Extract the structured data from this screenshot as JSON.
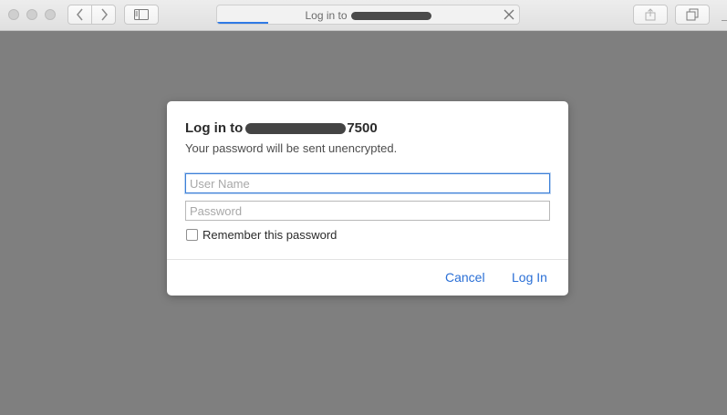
{
  "window": {
    "traffic_lights": [
      "close-light",
      "minimize-light",
      "zoom-light"
    ]
  },
  "toolbar": {
    "back_icon": "chevron-left-icon",
    "forward_icon": "chevron-right-icon",
    "sidebar_icon": "sidebar-icon",
    "share_icon": "share-icon",
    "tabs_icon": "tabs-overview-icon",
    "address": {
      "title_prefix": "Log in to",
      "title_host_redacted": true,
      "load_progress": 0.17,
      "stop_icon": "close-icon"
    }
  },
  "dialog": {
    "title_prefix": "Log in to",
    "title_suffix": "7500",
    "host_redacted": true,
    "subtitle": "Your password will be sent unencrypted.",
    "username_placeholder": "User Name",
    "username_value": "",
    "password_placeholder": "Password",
    "password_value": "",
    "remember_label": "Remember this password",
    "remember_checked": false,
    "cancel_label": "Cancel",
    "login_label": "Log In"
  },
  "colors": {
    "accent": "#2a6fd6",
    "backdrop": "#7f7f7f",
    "focus_ring": "#3d80d8"
  }
}
